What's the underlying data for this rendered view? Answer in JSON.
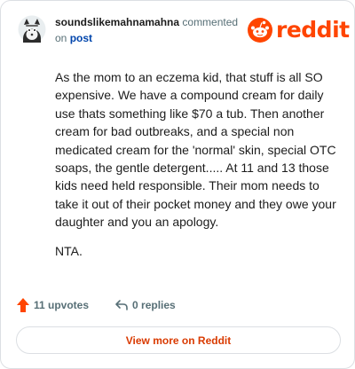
{
  "comment": {
    "username": "soundslikemahnamahna",
    "action_text": "commented",
    "on_text": "on",
    "post_link": "post",
    "paragraphs": [
      "As the mom to an eczema kid, that stuff is all SO expensive. We have a compound cream for daily use thats something like $70 a tub. Then another cream for bad outbreaks, and a special non medicated cream for the 'normal' skin, special OTC soaps, the gentle detergent..... At 11 and 13 those kids need held responsible. Their mom needs to take it out of their pocket money and they owe your daughter and you an apology.",
      "NTA."
    ]
  },
  "brand": {
    "name": "reddit",
    "icon": "reddit-snoo-icon",
    "color": "#ff4500"
  },
  "actions": {
    "upvotes_label": "11 upvotes",
    "replies_label": "0 replies",
    "upvote_icon": "upvote-arrow-icon",
    "upvote_color": "#ff4500",
    "reply_icon": "reply-icon"
  },
  "footer": {
    "view_more_label": "View more on Reddit",
    "link_color": "#d93a00"
  }
}
